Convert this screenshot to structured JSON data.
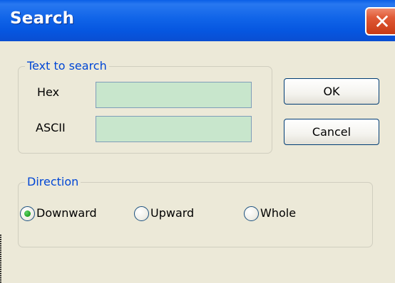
{
  "window": {
    "title": "Search"
  },
  "text_group": {
    "legend": "Text to search",
    "hex_label": "Hex",
    "hex_value": "",
    "ascii_label": "ASCII",
    "ascii_value": ""
  },
  "buttons": {
    "ok": "OK",
    "cancel": "Cancel"
  },
  "direction": {
    "legend": "Direction",
    "options": [
      {
        "label": "Downward",
        "selected": true
      },
      {
        "label": "Upward",
        "selected": false
      },
      {
        "label": "Whole",
        "selected": false
      }
    ]
  },
  "colors": {
    "title_bar": "#0A5FE6",
    "dialog_bg": "#ECE9D8",
    "legend_text": "#0046D5",
    "field_bg": "#C8E6CC",
    "close_button": "#E05A36"
  }
}
